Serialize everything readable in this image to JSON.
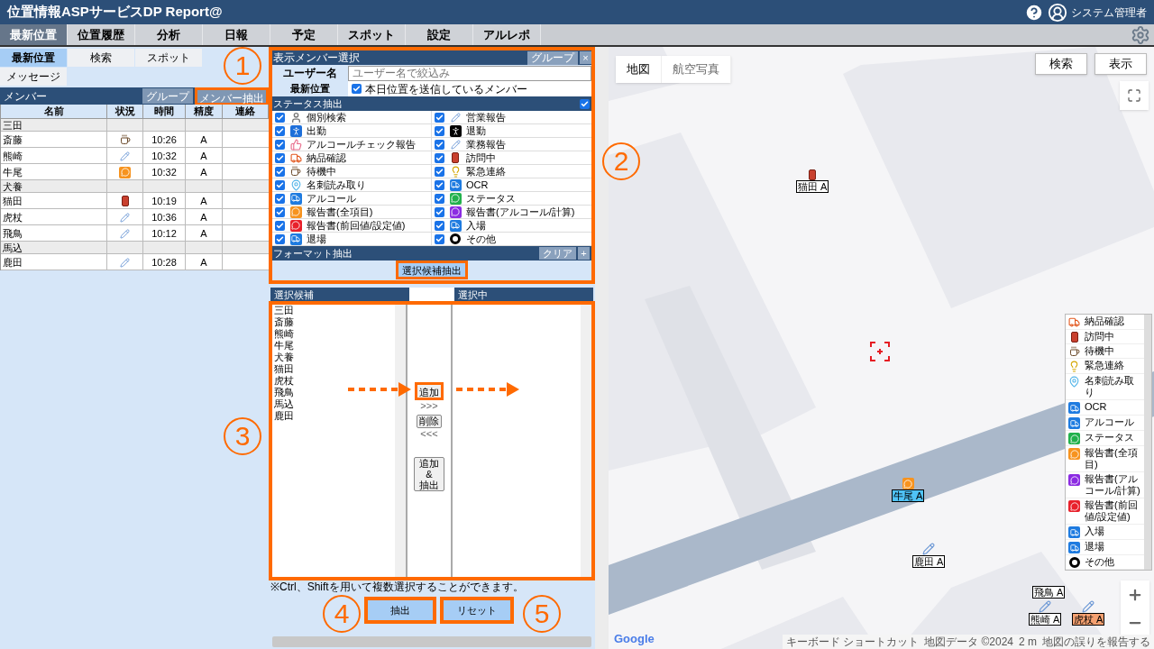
{
  "app": {
    "title": "位置情報ASPサービスDP Report@",
    "user": "システム管理者"
  },
  "main_tabs": [
    {
      "label": "最新位置",
      "selected": true
    },
    {
      "label": "位置履歴",
      "selected": false
    },
    {
      "label": "分析",
      "selected": false
    },
    {
      "label": "日報",
      "selected": false
    },
    {
      "label": "予定",
      "selected": false
    },
    {
      "label": "スポット",
      "selected": false
    },
    {
      "label": "設定",
      "selected": false
    },
    {
      "label": "アルレポ",
      "selected": false
    }
  ],
  "left_panel": {
    "sub_tabs": [
      {
        "label": "最新位置",
        "selected": true
      },
      {
        "label": "検索",
        "selected": false
      },
      {
        "label": "スポット",
        "selected": false
      },
      {
        "label": "メッセージ",
        "selected": false
      }
    ],
    "members_title": "メンバー",
    "buttons": [
      "グループ",
      "メンバー抽出"
    ],
    "table": {
      "columns": [
        "名前",
        "状況",
        "時間",
        "精度",
        "連絡"
      ],
      "rows": [
        {
          "kind": "group",
          "name": "三田"
        },
        {
          "kind": "member",
          "name": "斎藤",
          "icon": {
            "kind": "cup"
          },
          "time": "10:26",
          "accuracy": "A"
        },
        {
          "kind": "member",
          "name": "熊崎",
          "icon": {
            "kind": "memo"
          },
          "time": "10:32",
          "accuracy": "A"
        },
        {
          "kind": "member",
          "name": "牛尾",
          "icon": {
            "kind": "chat",
            "color": "#f7931e"
          },
          "time": "10:32",
          "accuracy": "A"
        },
        {
          "kind": "group",
          "name": "犬養"
        },
        {
          "kind": "member",
          "name": "猫田",
          "icon": {
            "kind": "box"
          },
          "time": "10:19",
          "accuracy": "A"
        },
        {
          "kind": "member",
          "name": "虎杖",
          "icon": {
            "kind": "memo"
          },
          "time": "10:36",
          "accuracy": "A"
        },
        {
          "kind": "member",
          "name": "飛鳥",
          "icon": {
            "kind": "memo"
          },
          "time": "10:12",
          "accuracy": "A"
        },
        {
          "kind": "group",
          "name": "馬込"
        },
        {
          "kind": "member",
          "name": "鹿田",
          "icon": {
            "kind": "memo"
          },
          "time": "10:28",
          "accuracy": "A"
        }
      ]
    }
  },
  "member_select": {
    "title": "表示メンバー選択",
    "header_buttons": [
      "グループ",
      "×"
    ],
    "username": {
      "label": "ユーザー名",
      "placeholder": "ユーザー名で絞込み"
    },
    "latest": {
      "label": "最新位置",
      "option": "本日位置を送信しているメンバー",
      "checked": true
    },
    "status_title": "ステータス抽出",
    "status_all_checked": true,
    "statuses": [
      {
        "label": "個別検索",
        "checked": true,
        "icon": {
          "kind": "search"
        }
      },
      {
        "label": "営業報告",
        "checked": true,
        "icon": {
          "kind": "memo"
        }
      },
      {
        "label": "出勤",
        "checked": true,
        "icon": {
          "kind": "walk"
        }
      },
      {
        "label": "退勤",
        "checked": true,
        "icon": {
          "kind": "exit"
        }
      },
      {
        "label": "アルコールチェック報告",
        "checked": true,
        "icon": {
          "kind": "thumb"
        }
      },
      {
        "label": "業務報告",
        "checked": true,
        "icon": {
          "kind": "memo"
        }
      },
      {
        "label": "納品確認",
        "checked": true,
        "icon": {
          "kind": "truck"
        }
      },
      {
        "label": "訪問中",
        "checked": true,
        "icon": {
          "kind": "box"
        }
      },
      {
        "label": "待機中",
        "checked": true,
        "icon": {
          "kind": "cup"
        }
      },
      {
        "label": "緊急連絡",
        "checked": true,
        "icon": {
          "kind": "bulb"
        }
      },
      {
        "label": "名刺読み取り",
        "checked": true,
        "icon": {
          "kind": "pin"
        }
      },
      {
        "label": "OCR",
        "checked": true,
        "icon": {
          "kind": "bus"
        }
      },
      {
        "label": "アルコール",
        "checked": true,
        "icon": {
          "kind": "bus"
        }
      },
      {
        "label": "ステータス",
        "checked": true,
        "icon": {
          "kind": "chat",
          "color": "#22b14c"
        }
      },
      {
        "label": "報告書(全項目)",
        "checked": true,
        "icon": {
          "kind": "chat",
          "color": "#f7931e"
        }
      },
      {
        "label": "報告書(アルコール/計算)",
        "checked": true,
        "icon": {
          "kind": "chat",
          "color": "#8b2be2"
        }
      },
      {
        "label": "報告書(前回値/設定値)",
        "checked": true,
        "icon": {
          "kind": "chat",
          "color": "#e8202a"
        }
      },
      {
        "label": "入場",
        "checked": true,
        "icon": {
          "kind": "bus"
        }
      },
      {
        "label": "退場",
        "checked": true,
        "icon": {
          "kind": "bus"
        }
      },
      {
        "label": "その他",
        "checked": true,
        "icon": {
          "kind": "ring"
        }
      }
    ],
    "format_title": "フォーマット抽出",
    "format_buttons": [
      "クリア",
      "+"
    ],
    "extract_candidates": "選択候補抽出"
  },
  "transfer": {
    "candidates_title": "選択候補",
    "selected_title": "選択中",
    "candidates": [
      "三田",
      "斎藤",
      "熊崎",
      "牛尾",
      "犬養",
      "猫田",
      "虎杖",
      "飛鳥",
      "馬込",
      "鹿田"
    ],
    "add": {
      "label": "追加",
      "arrows": ">>>"
    },
    "remove": {
      "label": "削除",
      "arrows": "<<<"
    },
    "add_extract": [
      "追加",
      "&",
      "抽出"
    ]
  },
  "note": "※Ctrl、Shiftを用いて複数選択することができます。",
  "actions": [
    "抽出",
    "リセット"
  ],
  "map": {
    "type_buttons": [
      {
        "label": "地図",
        "selected": true
      },
      {
        "label": "航空写真",
        "selected": false
      }
    ],
    "buttons": [
      "検索",
      "表示"
    ],
    "legend": [
      {
        "label": "納品確認",
        "icon": {
          "kind": "truck"
        }
      },
      {
        "label": "訪問中",
        "icon": {
          "kind": "box"
        }
      },
      {
        "label": "待機中",
        "icon": {
          "kind": "cup"
        }
      },
      {
        "label": "緊急連絡",
        "icon": {
          "kind": "bulb"
        }
      },
      {
        "label": "名刺読み取り",
        "icon": {
          "kind": "pin"
        }
      },
      {
        "label": "OCR",
        "icon": {
          "kind": "bus"
        }
      },
      {
        "label": "アルコール",
        "icon": {
          "kind": "bus"
        }
      },
      {
        "label": "ステータス",
        "icon": {
          "kind": "chat",
          "color": "#22b14c"
        }
      },
      {
        "label": "報告書(全項目)",
        "icon": {
          "kind": "chat",
          "color": "#f7931e"
        }
      },
      {
        "label": "報告書(アルコール/計算)",
        "icon": {
          "kind": "chat",
          "color": "#8b2be2"
        }
      },
      {
        "label": "報告書(前回値/設定値)",
        "icon": {
          "kind": "chat",
          "color": "#e8202a"
        }
      },
      {
        "label": "入場",
        "icon": {
          "kind": "bus"
        }
      },
      {
        "label": "退場",
        "icon": {
          "kind": "bus"
        }
      },
      {
        "label": "その他",
        "icon": {
          "kind": "ring"
        }
      }
    ],
    "markers": [
      {
        "label": "猫田 A",
        "icon": {
          "kind": "box"
        },
        "color": "#ffffff"
      },
      {
        "label": "牛尾 A",
        "icon": {
          "kind": "chat",
          "color": "#f7931e"
        },
        "color": "#4fc3f7"
      },
      {
        "label": "鹿田 A",
        "icon": {
          "kind": "memo"
        },
        "color": "#ffffff"
      },
      {
        "label": "飛鳥 A",
        "color": "#ffffff"
      },
      {
        "label": "熊崎 A",
        "icon": {
          "kind": "memo"
        },
        "color": "#ffffff"
      },
      {
        "label": "虎杖 A",
        "icon": {
          "kind": "memo"
        },
        "color": "#f4a070"
      }
    ],
    "logo": "Google",
    "attribution": [
      "キーボード ショートカット",
      "地図データ ©2024",
      "2 m",
      "地図の誤りを報告する"
    ]
  },
  "annotations": [
    "1",
    "2",
    "3",
    "4",
    "5"
  ]
}
